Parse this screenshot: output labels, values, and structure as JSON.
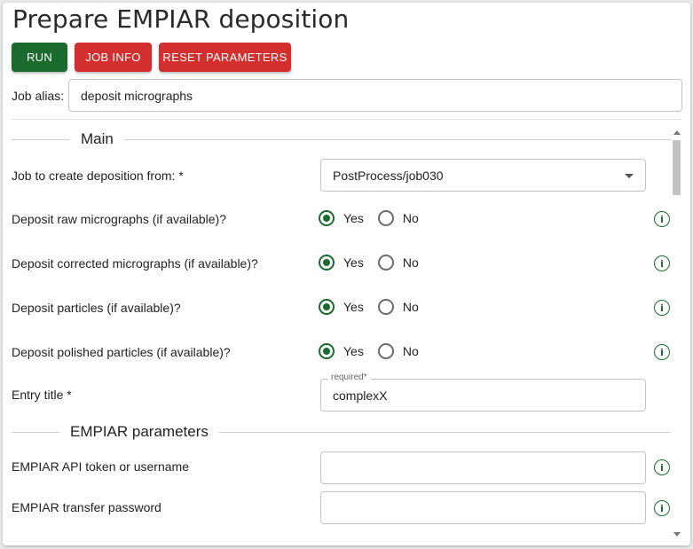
{
  "title": "Prepare EMPIAR deposition",
  "buttons": {
    "run": "RUN",
    "job_info": "JOB INFO",
    "reset": "RESET PARAMETERS"
  },
  "alias": {
    "label": "Job alias:",
    "value": "deposit micrographs"
  },
  "sections": {
    "main": "Main",
    "empiar": "EMPIAR parameters"
  },
  "fields": {
    "job_from": {
      "label": "Job to create deposition from: *",
      "value": "PostProcess/job030"
    },
    "raw_micrographs": {
      "label": "Deposit raw micrographs (if available)?",
      "selected": "Yes"
    },
    "corrected_micrographs": {
      "label": "Deposit corrected micrographs (if available)?",
      "selected": "Yes"
    },
    "particles": {
      "label": "Deposit particles (if available)?",
      "selected": "Yes"
    },
    "polished_particles": {
      "label": "Deposit polished particles (if available)?",
      "selected": "Yes"
    },
    "entry_title": {
      "label": "Entry title *",
      "float_label": "required*",
      "value": "complexX"
    },
    "api_token": {
      "label": "EMPIAR API token or username",
      "value": ""
    },
    "transfer_password": {
      "label": "EMPIAR transfer password",
      "value": ""
    }
  },
  "radio_options": {
    "yes": "Yes",
    "no": "No"
  },
  "icons": {
    "info": "info-circle-icon",
    "dropdown": "chevron-down-icon"
  },
  "colors": {
    "primary_green": "#1b6b2e",
    "danger_red": "#d32f2f"
  }
}
